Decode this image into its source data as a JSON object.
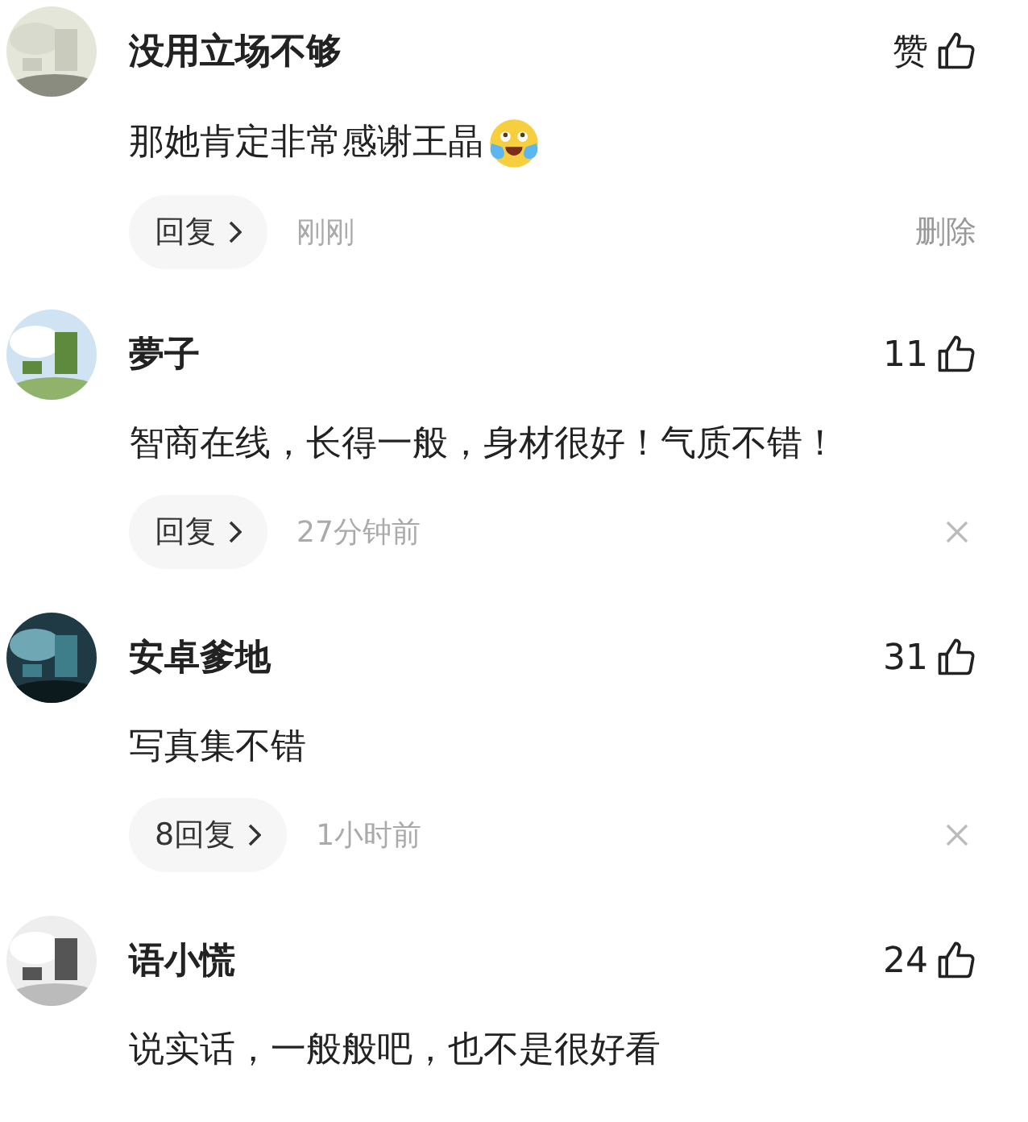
{
  "comments": [
    {
      "name": "没用立场不够",
      "likes": "赞",
      "text": "那她肯定非常感谢王晶",
      "emoji": true,
      "reply": "回复",
      "time": "刚刚",
      "action": {
        "kind": "delete",
        "label": "删除"
      }
    },
    {
      "name": "夢子",
      "likes": "11",
      "text": "智商在线，长得一般，身材很好！气质不错！",
      "emoji": false,
      "reply": "回复",
      "time": "27分钟前",
      "action": {
        "kind": "dismiss"
      }
    },
    {
      "name": "安卓爹地",
      "likes": "31",
      "text": "写真集不错",
      "emoji": false,
      "reply": "8回复",
      "time": "1小时前",
      "action": {
        "kind": "dismiss"
      }
    },
    {
      "name": "语小慌",
      "likes": "24",
      "text": "说实话，一般般吧，也不是很好看",
      "emoji": false
    }
  ]
}
